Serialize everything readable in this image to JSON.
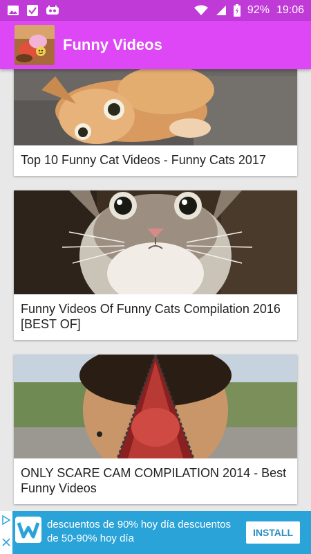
{
  "status_bar": {
    "battery_percent": "92%",
    "time": "19:06",
    "icons": [
      "image-icon",
      "check-icon",
      "game-icon",
      "wifi-icon",
      "signal-icon",
      "battery-icon"
    ]
  },
  "app_bar": {
    "title": "Funny Videos",
    "background": "#dd47f5"
  },
  "videos": [
    {
      "title": "Top 10 Funny Cat Videos - Funny Cats 2017"
    },
    {
      "title": "Funny Videos Of Funny Cats Compilation 2016 [BEST OF]"
    },
    {
      "title": "ONLY SCARE CAM COMPILATION 2014 - Best Funny Videos"
    }
  ],
  "ad": {
    "text": "descuentos de 90% hoy día descuentos de 50-90% hoy día",
    "button_label": "INSTALL",
    "logo_letter": "w",
    "background": "#2aa3d8"
  }
}
